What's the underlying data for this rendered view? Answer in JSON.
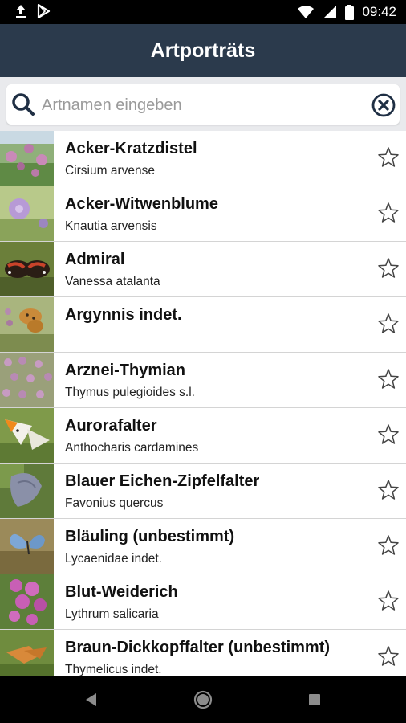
{
  "status_bar": {
    "time": "09:42",
    "left_icons": [
      "upload-icon",
      "play-store-icon"
    ],
    "right_icons": [
      "wifi-icon",
      "signal-icon",
      "battery-icon"
    ]
  },
  "app_bar": {
    "title": "Artporträts"
  },
  "search": {
    "placeholder": "Artnamen eingeben",
    "value": ""
  },
  "species": [
    {
      "name": "Acker-Kratzdistel",
      "latin": "Cirsium arvense",
      "favorite": false,
      "thumbnail": "thistle-image"
    },
    {
      "name": "Acker-Witwenblume",
      "latin": "Knautia arvensis",
      "favorite": false,
      "thumbnail": "scabious-image"
    },
    {
      "name": "Admiral",
      "latin": "Vanessa atalanta",
      "favorite": false,
      "thumbnail": "red-admiral-image"
    },
    {
      "name": "Argynnis indet.",
      "latin": "",
      "favorite": false,
      "thumbnail": "fritillary-image"
    },
    {
      "name": "Arznei-Thymian",
      "latin": "Thymus pulegioides s.l.",
      "favorite": false,
      "thumbnail": "thyme-image"
    },
    {
      "name": "Aurorafalter",
      "latin": "Anthocharis cardamines",
      "favorite": false,
      "thumbnail": "orange-tip-image"
    },
    {
      "name": "Blauer Eichen-Zipfelfalter",
      "latin": "Favonius quercus",
      "favorite": false,
      "thumbnail": "purple-hairstreak-image"
    },
    {
      "name": "Bläuling (unbestimmt)",
      "latin": "Lycaenidae indet.",
      "favorite": false,
      "thumbnail": "blue-butterfly-image"
    },
    {
      "name": "Blut-Weiderich",
      "latin": "Lythrum salicaria",
      "favorite": false,
      "thumbnail": "loosestrife-image"
    },
    {
      "name": "Braun-Dickkopffalter (unbestimmt)",
      "latin": "Thymelicus indet.",
      "favorite": false,
      "thumbnail": "skipper-image"
    }
  ],
  "colors": {
    "app_bar": "#2b3a4c",
    "search_area": "#e9eaed",
    "icon_accent": "#1f2f44"
  }
}
